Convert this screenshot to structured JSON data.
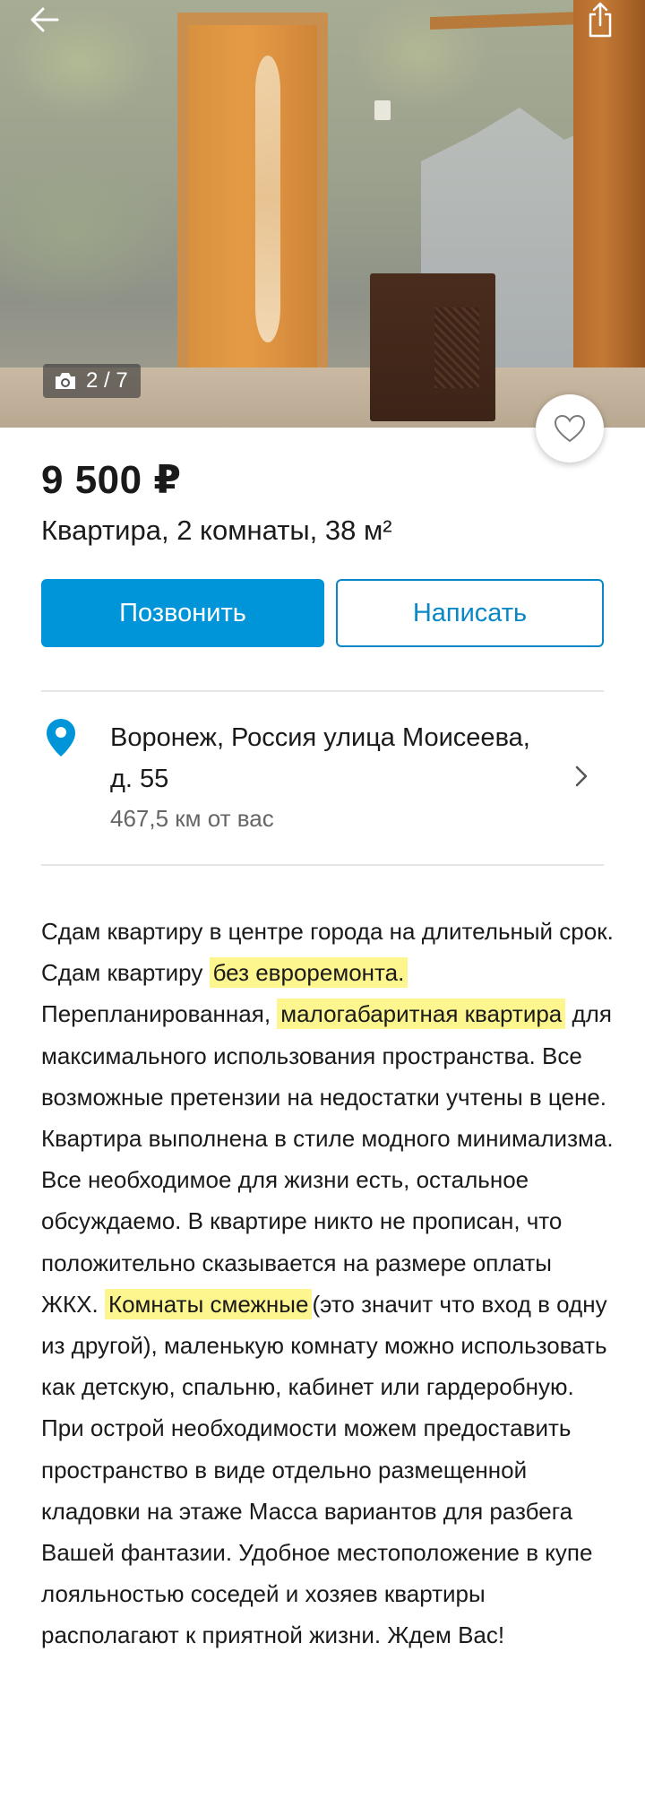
{
  "photo": {
    "counter_text": "2 / 7",
    "icons": {
      "back": "arrow-left-icon",
      "share": "share-icon",
      "camera": "camera-icon",
      "favorite": "heart-icon"
    }
  },
  "listing": {
    "price": "9 500 ₽",
    "subtitle": "Квартира, 2 комнаты, 38 м²"
  },
  "actions": {
    "call_label": "Позвонить",
    "write_label": "Написать"
  },
  "location": {
    "address": "Воронеж, Россия улица Моисеева, д. 55",
    "distance": "467,5  км от вас",
    "icons": {
      "pin": "location-pin-icon",
      "chevron": "chevron-right-icon"
    }
  },
  "description": {
    "p1": "Сдам квартиру в центре города на длительный срок.",
    "p2_before": "Сдам квартиру ",
    "p2_highlight": "без евроремонта.",
    "p3_before": "Перепланированная, ",
    "p3_highlight": "малогабаритная квартира",
    "p3_after": " для максимального использования пространства. Все возможные претензии на недостатки учтены в цене. Квартира выполнена в стиле модного минимализма. Все необходимое для жизни есть, остальное обсуждаемо. В квартире никто не прописан, что положительно сказывается на размере оплаты ЖКХ. ",
    "p3_highlight2": "Комнаты смежные",
    "p3_end": "(это значит что вход в одну из другой), маленькую комнату можно использовать как детскую, спальню, кабинет или гардеробную. При острой необходимости можем предоставить пространство в виде отдельно размещенной кладовки на этаже Масса вариантов для разбега Вашей фантазии. Удобное местоположение в купе лояльностью соседей и хозяев квартиры располагают к приятной жизни. Ждем Вас!"
  },
  "colors": {
    "accent": "#0095d9",
    "highlight": "#fdf58e"
  }
}
